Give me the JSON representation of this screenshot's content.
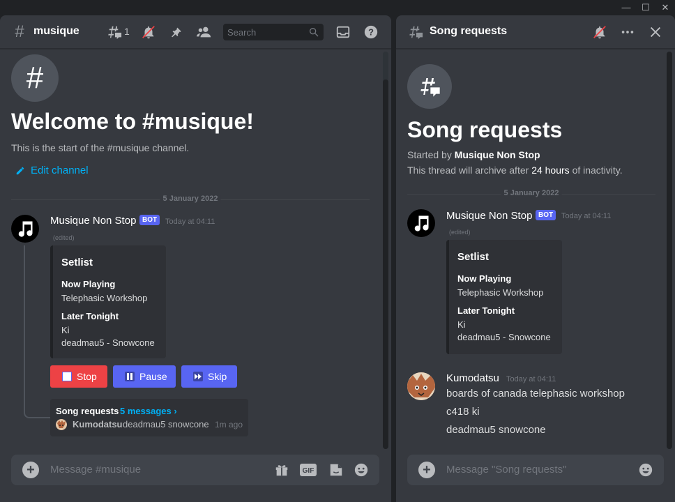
{
  "window": {
    "minimize": "—",
    "maximize": "☐",
    "close": "✕"
  },
  "left": {
    "channel_name": "musique",
    "threads_count": "1",
    "search_placeholder": "Search",
    "welcome_title": "Welcome to #musique!",
    "welcome_sub": "This is the start of the #musique channel.",
    "edit_channel": "Edit channel",
    "date_divider": "5 January 2022",
    "message": {
      "author": "Musique Non Stop",
      "badge": "BOT",
      "timestamp": "Today at 04:11",
      "edited": "(edited)",
      "embed": {
        "title": "Setlist",
        "fields": [
          {
            "name": "Now Playing",
            "value": "Telephasic Workshop"
          },
          {
            "name": "Later Tonight",
            "value": "Ki",
            "value2": "deadmau5 - Snowcone"
          }
        ]
      },
      "buttons": [
        {
          "label": "Stop",
          "icon": "stop-icon",
          "color": "#ed4245"
        },
        {
          "label": "Pause",
          "icon": "pause-icon",
          "color": "#5865f2"
        },
        {
          "label": "Skip",
          "icon": "skip-icon",
          "color": "#5865f2"
        }
      ],
      "thread": {
        "name": "Song requests",
        "count_link": "5 messages ›",
        "last_author": "Kumodatsu",
        "last_message": "deadmau5 snowcone",
        "last_time": "1m ago"
      }
    },
    "composer_placeholder": "Message #musique"
  },
  "right": {
    "thread_name": "Song requests",
    "title": "Song requests",
    "started_by_prefix": "Started by",
    "started_by": "Musique Non Stop",
    "archive_prefix": "This thread will archive after",
    "archive_duration": "24 hours",
    "archive_suffix": "of inactivity.",
    "date_divider": "5 January 2022",
    "bot_message": {
      "author": "Musique Non Stop",
      "badge": "BOT",
      "timestamp": "Today at 04:11",
      "edited": "(edited)",
      "embed": {
        "title": "Setlist",
        "fields": [
          {
            "name": "Now Playing",
            "value": "Telephasic Workshop"
          },
          {
            "name": "Later Tonight",
            "value": "Ki",
            "value2": "deadmau5 - Snowcone"
          }
        ]
      }
    },
    "user_message": {
      "author": "Kumodatsu",
      "timestamp": "Today at 04:11",
      "lines": [
        "boards of canada telephasic workshop",
        "c418 ki",
        "deadmau5 snowcone"
      ]
    },
    "composer_placeholder": "Message \"Song requests\""
  },
  "colors": {
    "bg": "#36393f",
    "accent": "#5865f2",
    "danger": "#ed4245",
    "link": "#00b0f4"
  }
}
